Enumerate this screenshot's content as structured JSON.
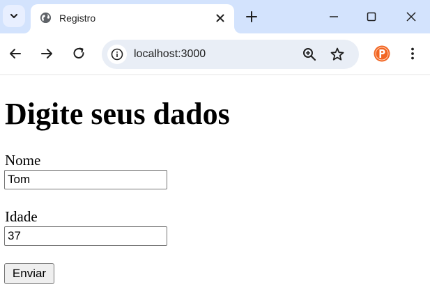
{
  "browser": {
    "tab": {
      "title": "Registro"
    },
    "address_bar": {
      "url": "localhost:3000"
    }
  },
  "page": {
    "heading": "Digite seus dados",
    "form": {
      "name_label": "Nome",
      "name_value": "Tom",
      "age_label": "Idade",
      "age_value": "37",
      "submit_label": "Enviar"
    }
  },
  "icons": {
    "tab_search": "chevron-down-icon",
    "favicon": "globe-icon",
    "close_tab": "close-icon",
    "new_tab": "plus-icon",
    "back": "arrow-left-icon",
    "forward": "arrow-right-icon",
    "reload": "reload-icon",
    "site_info": "info-icon",
    "zoom": "zoom-in-icon",
    "bookmark": "star-icon",
    "extension": "extension-p-icon",
    "menu": "kebab-menu-icon"
  },
  "colors": {
    "tabstrip": "#d3e3fd",
    "omnibox": "#e9eef6",
    "extension_orange": "#f26522"
  }
}
